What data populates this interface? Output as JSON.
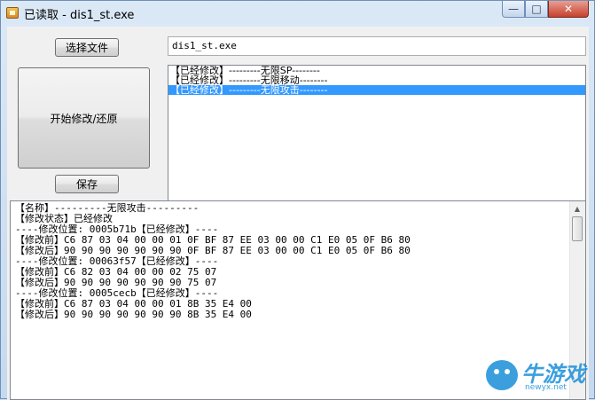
{
  "window": {
    "title": "已读取 - dis1_st.exe",
    "minimize_glyph": "—",
    "maximize_glyph": "□",
    "close_glyph": "✕"
  },
  "toolbar": {
    "choose_file_label": "选择文件",
    "start_modify_label": "开始修改/还原",
    "save_label": "保存"
  },
  "file": {
    "path": "dis1_st.exe"
  },
  "mod_list": {
    "items": [
      {
        "label": "【已经修改】---------无限SP--------",
        "selected": false
      },
      {
        "label": "【已经修改】---------无限移动--------",
        "selected": false
      },
      {
        "label": "【已经修改】---------无限攻击--------",
        "selected": true
      }
    ]
  },
  "output": {
    "lines": [
      "【名称】---------无限攻击---------",
      "【修改状态】已经修改",
      "----修改位置: 0005b71b【已经修改】----",
      "【修改前】C6 87 03 04 00 00 01 0F BF 87 EE 03 00 00 C1 E0 05 0F B6 80",
      "【修改后】90 90 90 90 90 90 90 0F BF 87 EE 03 00 00 C1 E0 05 0F B6 80",
      "----修改位置: 00063f57【已经修改】----",
      "【修改前】C6 82 03 04 00 00 02 75 07",
      "【修改后】90 90 90 90 90 90 90 75 07",
      "----修改位置: 0005cecb【已经修改】----",
      "【修改前】C6 87 03 04 00 00 01 8B 35 E4 00",
      "【修改后】90 90 90 90 90 90 90 8B 35 E4 00"
    ]
  },
  "watermark": {
    "brand": "牛游戏",
    "url": "newyx.net"
  },
  "colors": {
    "selection": "#3399ff",
    "title_bar": "#c9dcf0"
  }
}
